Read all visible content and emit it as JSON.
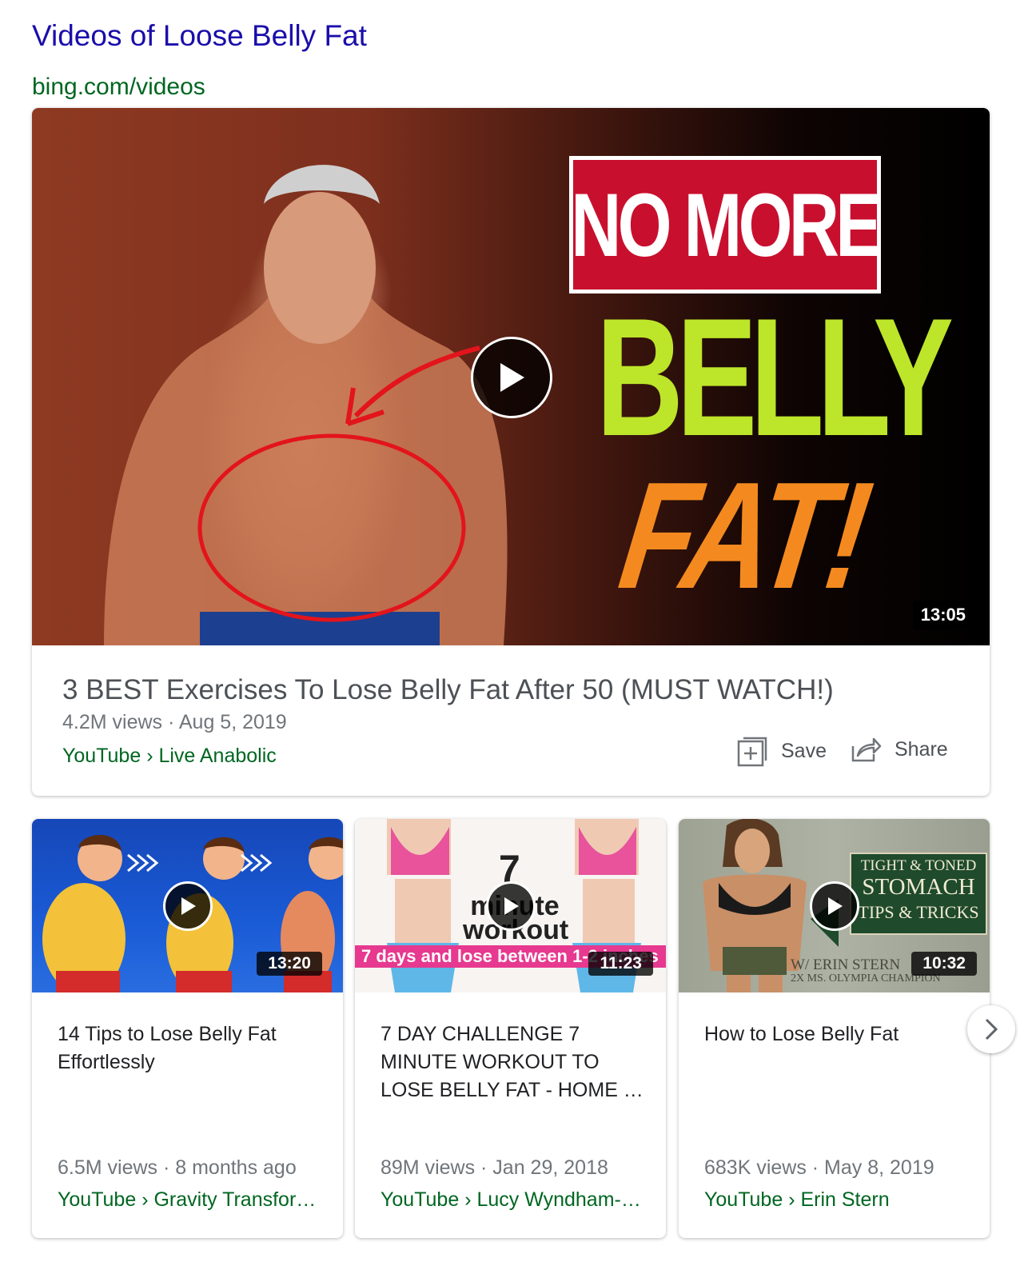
{
  "header": {
    "title": "Videos of Loose Belly Fat",
    "source": "bing.com/videos"
  },
  "featured": {
    "thumb_text": {
      "line1": "NO MORE",
      "line2": "BELLY",
      "line3": "FAT!"
    },
    "duration": "13:05",
    "title": "3 BEST Exercises To Lose Belly Fat After 50 (MUST WATCH!)",
    "meta": "4.2M views · Aug 5, 2019",
    "source": "YouTube › Live Anabolic",
    "save_label": "Save",
    "share_label": "Share"
  },
  "cards": [
    {
      "duration": "13:20",
      "title": "14 Tips to Lose Belly Fat\nEffortlessly",
      "meta": "6.5M views · 8 months ago",
      "source": "YouTube › Gravity Transfor…"
    },
    {
      "duration": "11:23",
      "thumb_big": "7",
      "thumb_workout": "minute\nworkout",
      "thumb_strip": "7 days and lose between 1-2 inches",
      "title": "7 DAY CHALLENGE 7\nMINUTE WORKOUT TO\nLOSE BELLY FAT - HOME …",
      "meta": "89M views · Jan 29, 2018",
      "source": "YouTube › Lucy Wyndham-…"
    },
    {
      "duration": "10:32",
      "thumb_box": {
        "l1": "TIGHT & TONED",
        "l2": "STOMACH",
        "l3": "TIPS & TRICKS"
      },
      "thumb_credit": "W/ ERIN STERN",
      "thumb_credit2": "2X MS. OLYMPIA CHAMPION",
      "title": "How to Lose Belly Fat",
      "meta": "683K views · May 8, 2019",
      "source": "YouTube › Erin Stern"
    }
  ],
  "icons": {
    "play": "play-icon",
    "save": "add-to-collection-icon",
    "share": "share-icon",
    "next": "chevron-right-icon"
  }
}
